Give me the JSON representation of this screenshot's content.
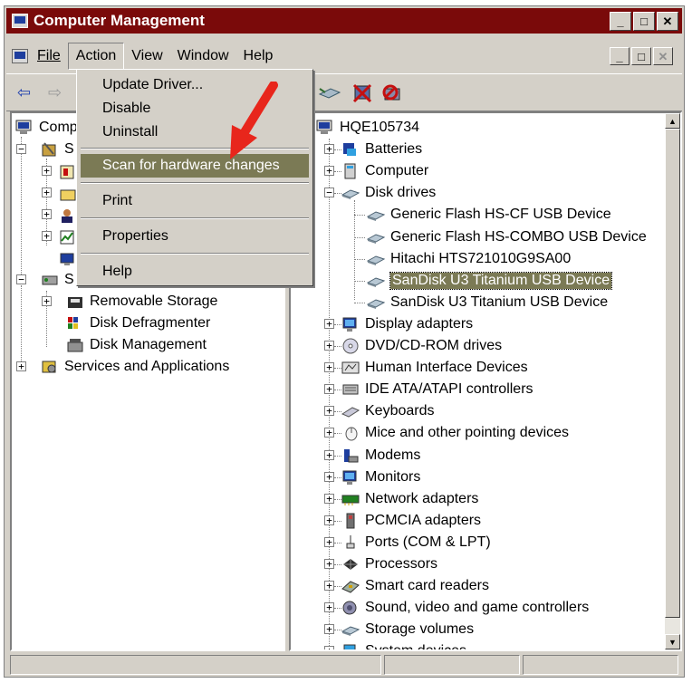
{
  "window": {
    "title": "Computer Management"
  },
  "title_buttons": {
    "minimize": "_",
    "maximize": "□",
    "close": "✕"
  },
  "menubar": {
    "items": [
      {
        "label": "File"
      },
      {
        "label": "Action"
      },
      {
        "label": "View"
      },
      {
        "label": "Window"
      },
      {
        "label": "Help"
      }
    ]
  },
  "action_menu": {
    "items": [
      {
        "label": "Update Driver..."
      },
      {
        "label": "Disable"
      },
      {
        "label": "Uninstall"
      },
      {
        "label": "Scan for hardware changes"
      },
      {
        "label": "Print"
      },
      {
        "label": "Properties"
      },
      {
        "label": "Help"
      }
    ],
    "highlighted": "Scan for hardware changes"
  },
  "left_tree": {
    "items": [
      {
        "label": "Comp"
      },
      {
        "label": "S"
      },
      {
        "label": "S"
      },
      {
        "label": "Removable Storage"
      },
      {
        "label": "Disk Defragmenter"
      },
      {
        "label": "Disk Management"
      },
      {
        "label": "Services and Applications"
      }
    ]
  },
  "device_tree": {
    "root": "HQE105734",
    "items": [
      {
        "label": "Batteries",
        "icon": "battery-icon"
      },
      {
        "label": "Computer",
        "icon": "computer-icon"
      },
      {
        "label": "Disk drives",
        "icon": "disk-drive-icon"
      },
      {
        "label": "Generic Flash HS-CF USB Device",
        "icon": "disk-drive-icon"
      },
      {
        "label": "Generic Flash HS-COMBO USB Device",
        "icon": "disk-drive-icon"
      },
      {
        "label": "Hitachi HTS721010G9SA00",
        "icon": "disk-drive-icon"
      },
      {
        "label": "SanDisk U3 Titanium USB Device",
        "icon": "disk-drive-icon"
      },
      {
        "label": "SanDisk U3 Titanium USB Device",
        "icon": "disk-drive-icon"
      },
      {
        "label": "Display adapters",
        "icon": "display-adapter-icon"
      },
      {
        "label": "DVD/CD-ROM drives",
        "icon": "dvd-icon"
      },
      {
        "label": "Human Interface Devices",
        "icon": "hid-icon"
      },
      {
        "label": "IDE ATA/ATAPI controllers",
        "icon": "ide-controller-icon"
      },
      {
        "label": "Keyboards",
        "icon": "keyboard-icon"
      },
      {
        "label": "Mice and other pointing devices",
        "icon": "mouse-icon"
      },
      {
        "label": "Modems",
        "icon": "modem-icon"
      },
      {
        "label": "Monitors",
        "icon": "monitor-icon"
      },
      {
        "label": "Network adapters",
        "icon": "network-adapter-icon"
      },
      {
        "label": "PCMCIA adapters",
        "icon": "pcmcia-icon"
      },
      {
        "label": "Ports (COM & LPT)",
        "icon": "port-icon"
      },
      {
        "label": "Processors",
        "icon": "processor-icon"
      },
      {
        "label": "Smart card readers",
        "icon": "smart-card-icon"
      },
      {
        "label": "Sound, video and game controllers",
        "icon": "sound-icon"
      },
      {
        "label": "Storage volumes",
        "icon": "storage-volume-icon"
      },
      {
        "label": "System devices",
        "icon": "system-device-icon"
      }
    ],
    "selected": "SanDisk U3 Titanium USB Device"
  },
  "colors": {
    "titlebar": "#7a0a0a",
    "highlight": "#7b7a55",
    "face": "#d4d0c8",
    "arrow": "#e8261c"
  }
}
